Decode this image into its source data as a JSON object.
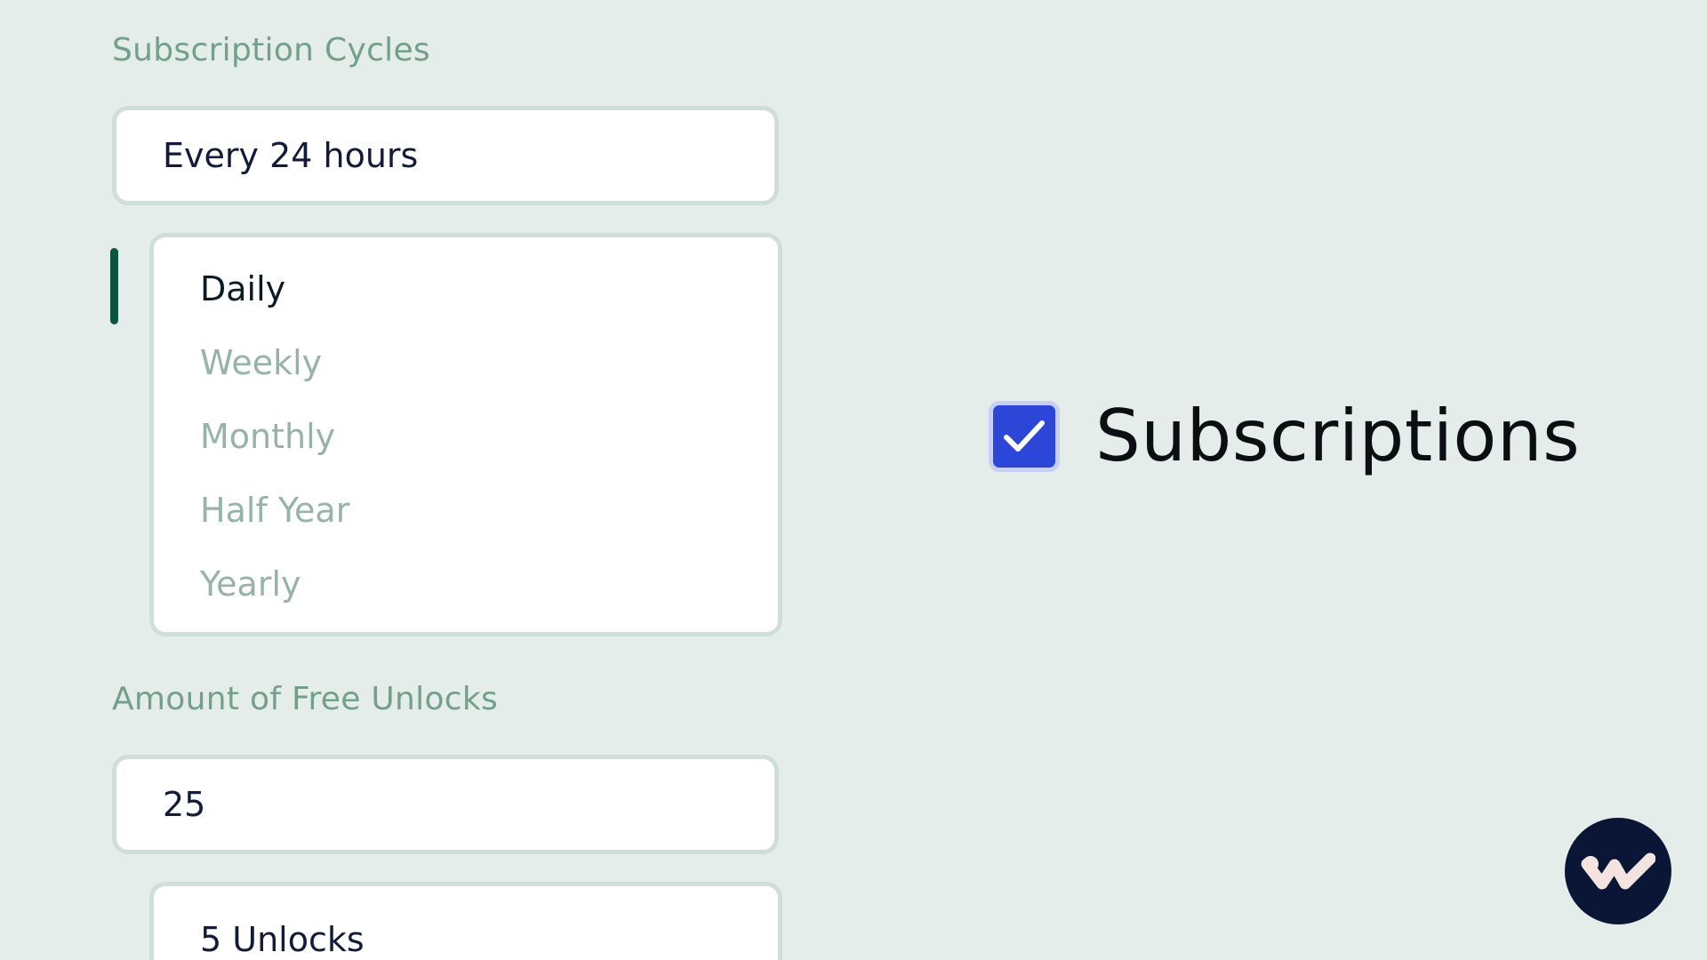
{
  "subscription_cycles": {
    "label": "Subscription Cycles",
    "current_value": "Every 24 hours",
    "options": [
      "Daily",
      "Weekly",
      "Monthly",
      "Half Year",
      "Yearly"
    ],
    "selected_option": "Daily"
  },
  "free_unlocks": {
    "label": "Amount of Free Unlocks",
    "current_value": "25",
    "visible_option": "5 Unlocks"
  },
  "feature": {
    "checkbox_checked": true,
    "title": "Subscriptions"
  },
  "icons": {
    "checkbox": "checkmark-icon",
    "logo": "brand-logo-icon"
  },
  "colors": {
    "background": "#e5edea",
    "label": "#72a08a",
    "selected_indicator": "#0b5440",
    "checkbox": "#2c47d8",
    "logo_bg": "#0b1535"
  }
}
